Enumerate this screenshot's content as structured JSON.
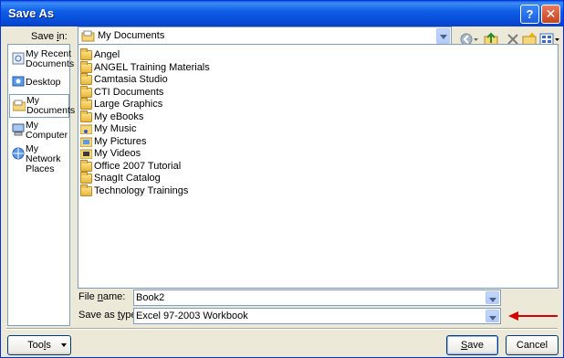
{
  "window": {
    "title": "Save As",
    "help_glyph": "?",
    "close_glyph": "✕"
  },
  "save_in": {
    "label_pre": "Save ",
    "label_ul": "i",
    "label_post": "n:",
    "value": "My Documents"
  },
  "toolbar": {
    "icons": [
      "back-icon",
      "up-folder-icon",
      "delete-icon",
      "new-folder-icon",
      "views-icon"
    ]
  },
  "places": [
    {
      "label": "My Recent Documents",
      "icon": "recent-icon"
    },
    {
      "label": "Desktop",
      "icon": "desktop-icon"
    },
    {
      "label": "My Documents",
      "icon": "my-documents-icon",
      "selected": true
    },
    {
      "label": "My Computer",
      "icon": "computer-icon"
    },
    {
      "label": "My Network Places",
      "icon": "network-icon"
    }
  ],
  "files": [
    "Angel",
    "ANGEL Training Materials",
    "Camtasia Studio",
    "CTI Documents",
    "Large Graphics",
    "My eBooks",
    "My Music",
    "My Pictures",
    "My Videos",
    "Office 2007 Tutorial",
    "SnagIt Catalog",
    "Technology Trainings"
  ],
  "file_name": {
    "label_pre": "File ",
    "label_ul": "n",
    "label_post": "ame:",
    "value": "Book2"
  },
  "save_type": {
    "label_pre": "Save as ",
    "label_ul": "t",
    "label_post": "ype:",
    "value": "Excel 97-2003 Workbook"
  },
  "buttons": {
    "tools_pre": "Too",
    "tools_ul": "l",
    "tools_post": "s",
    "save_ul": "S",
    "save_post": "ave",
    "cancel": "Cancel"
  },
  "colors": {
    "title_bar": "#0a5fe8",
    "arrow": "#d40000"
  }
}
